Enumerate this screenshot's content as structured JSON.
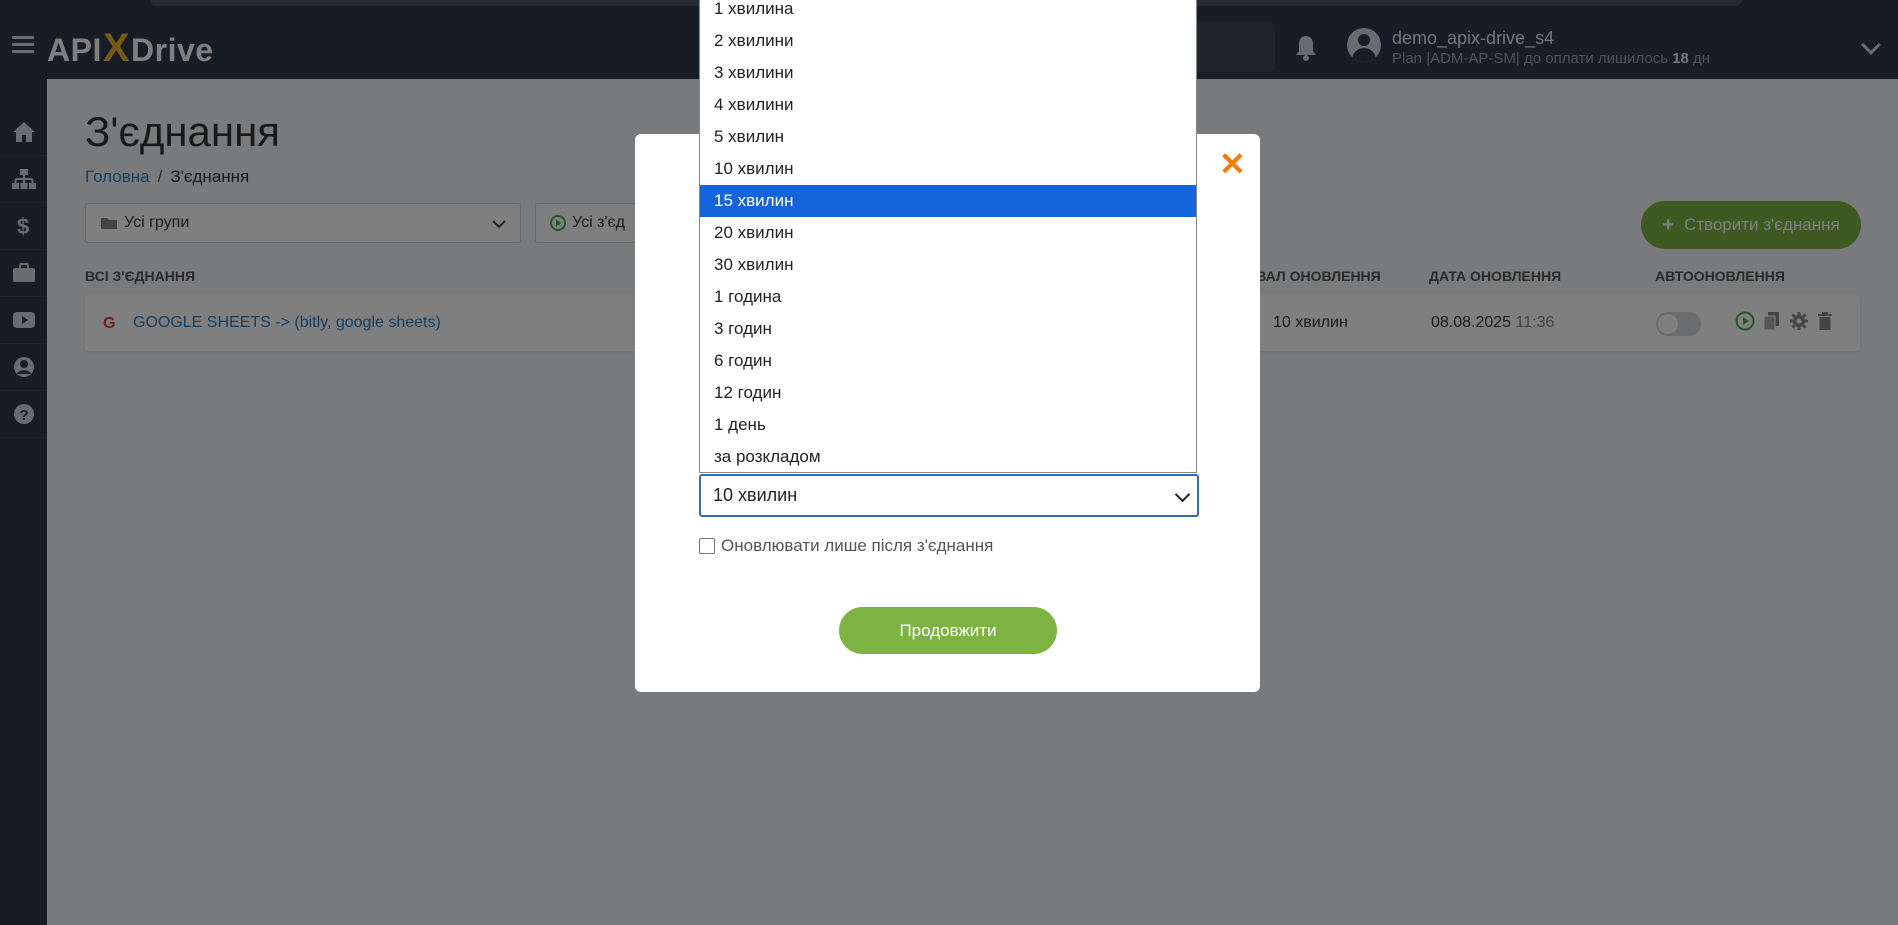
{
  "header": {
    "logo_api": "API",
    "logo_x": "X",
    "logo_drive": "Drive",
    "user_name": "demo_apix-drive_s4",
    "plan_prefix": "Plan |ADM-AP-SM| до оплати лишилось",
    "plan_days": "18",
    "plan_suffix": "дн"
  },
  "page": {
    "title": "З'єднання",
    "breadcrumb_home": "Головна",
    "breadcrumb_sep": "/",
    "breadcrumb_current": "З'єднання"
  },
  "filters": {
    "groups_label": "Усі групи",
    "status_label": "Усі з'єд"
  },
  "create_button": "Створити з'єднання",
  "table": {
    "col_all": "ВСІ З'ЄДНАННЯ",
    "col_interval": "ІНТЕРВАЛ ОНОВЛЕННЯ",
    "col_date": "ДАТА ОНОВЛЕННЯ",
    "col_auto": "АВТООНОВЛЕННЯ",
    "rows": [
      {
        "name": "GOOGLE SHEETS -> (bitly, google sheets)",
        "interval": "10 хвилин",
        "date": "08.08.2025",
        "time": "11:36",
        "auto_update": false
      }
    ]
  },
  "modal": {
    "selected_value": "10 хвилин",
    "checkbox_label": "Оновлювати лише після з'єднання",
    "continue_label": "Продовжити",
    "close_glyph": "✕"
  },
  "dropdown": {
    "highlighted_index": 6,
    "options": [
      "1 хвилина",
      "2 хвилини",
      "3 хвилини",
      "4 хвилини",
      "5 хвилин",
      "10 хвилин",
      "15 хвилин",
      "20 хвилин",
      "30 хвилин",
      "1 година",
      "3 годин",
      "6 годин",
      "12 годин",
      "1 день",
      "за розкладом"
    ]
  },
  "colors": {
    "topbar": "#2c3b48",
    "accent_green": "#7cb342",
    "link_blue": "#2d7fc1",
    "highlight_blue": "#1664d9",
    "close_orange": "#f57c00"
  },
  "icons": {
    "sidebar": [
      "home-icon",
      "sitemap-icon",
      "dollar-icon",
      "briefcase-icon",
      "youtube-icon",
      "user-icon",
      "help-icon"
    ]
  }
}
